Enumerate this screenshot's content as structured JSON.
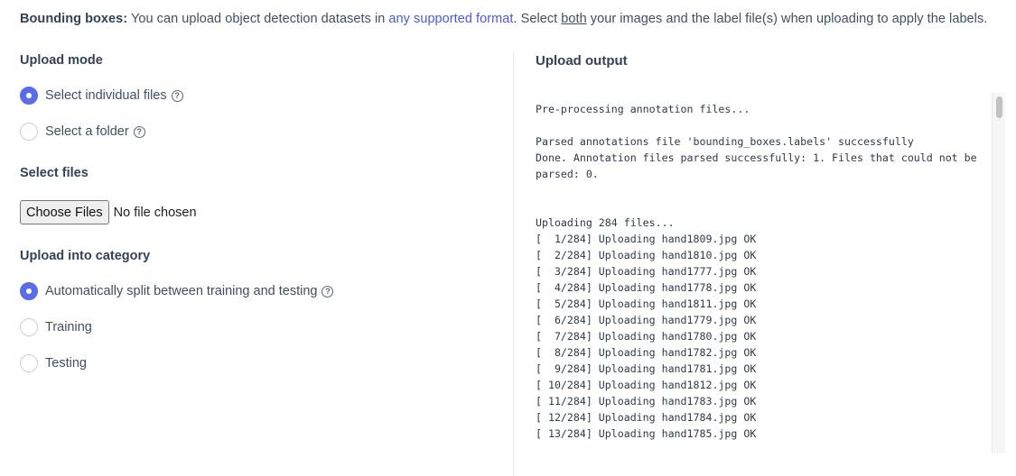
{
  "info": {
    "bold_label": "Bounding boxes:",
    "text_before_link": " You can upload object detection datasets in ",
    "link_text": "any supported format",
    "text_after_link": ". Select ",
    "underlined": "both",
    "text_end": " your images and the label file(s) when uploading to apply the labels."
  },
  "upload_mode": {
    "title": "Upload mode",
    "options": [
      {
        "label": "Select individual files",
        "selected": true,
        "help": "?"
      },
      {
        "label": "Select a folder",
        "selected": false,
        "help": "?"
      }
    ]
  },
  "select_files": {
    "title": "Select files",
    "button_label": "Choose Files",
    "status": "No file chosen"
  },
  "category": {
    "title": "Upload into category",
    "options": [
      {
        "label": "Automatically split between training and testing",
        "selected": true,
        "help": "?"
      },
      {
        "label": "Training",
        "selected": false
      },
      {
        "label": "Testing",
        "selected": false
      }
    ]
  },
  "output": {
    "title": "Upload output",
    "lines": [
      "Pre-processing annotation files...",
      "",
      "Parsed annotations file 'bounding_boxes.labels' successfully",
      "Done. Annotation files parsed successfully: 1. Files that could not be",
      "parsed: 0.",
      "",
      "",
      "Uploading 284 files...",
      "[  1/284] Uploading hand1809.jpg OK",
      "[  2/284] Uploading hand1810.jpg OK",
      "[  3/284] Uploading hand1777.jpg OK",
      "[  4/284] Uploading hand1778.jpg OK",
      "[  5/284] Uploading hand1811.jpg OK",
      "[  6/284] Uploading hand1779.jpg OK",
      "[  7/284] Uploading hand1780.jpg OK",
      "[  8/284] Uploading hand1782.jpg OK",
      "[  9/284] Uploading hand1781.jpg OK",
      "[ 10/284] Uploading hand1812.jpg OK",
      "[ 11/284] Uploading hand1783.jpg OK",
      "[ 12/284] Uploading hand1784.jpg OK",
      "[ 13/284] Uploading hand1785.jpg OK"
    ]
  },
  "colors": {
    "accent": "#5b6ce8",
    "link": "#4a5bd4",
    "text": "#3f4f63"
  }
}
